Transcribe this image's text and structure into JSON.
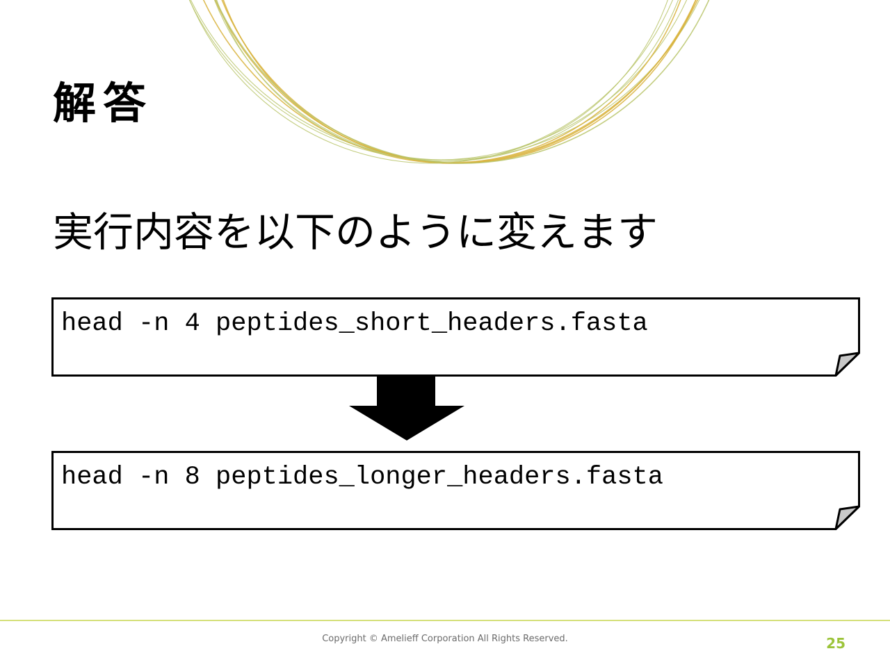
{
  "slide": {
    "title": "解答",
    "subtitle": "実行内容を以下のように変えます",
    "before_command": "head -n 4 peptides_short_headers.fasta",
    "after_command": "head -n 8 peptides_longer_headers.fasta",
    "copyright": "Copyright © Amelieff Corporation All Rights Reserved.",
    "page_number": "25"
  },
  "colors": {
    "accent_line": "#d5e07a",
    "page_number": "#9cc43a",
    "ring_gold": "#d8b23a",
    "ring_green": "#b9c46a"
  },
  "icons": {
    "arrow": "down-arrow-icon",
    "decoration": "rings-decoration"
  }
}
